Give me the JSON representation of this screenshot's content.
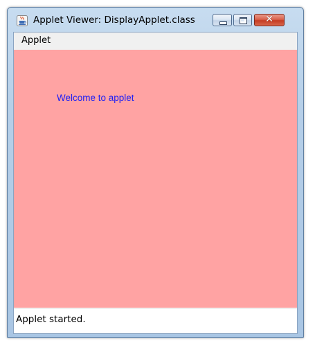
{
  "window": {
    "title": "Applet Viewer: DisplayApplet.class",
    "app_icon": "java-coffee-cup-icon",
    "controls": {
      "minimize_icon": "minimize-icon",
      "maximize_icon": "maximize-icon",
      "close_icon": "close-icon",
      "close_glyph": "✕"
    }
  },
  "menubar": {
    "items": [
      {
        "label": "Applet"
      }
    ]
  },
  "applet": {
    "background_color": "#ffa3a3",
    "text": "Welcome to applet",
    "text_color": "#1f1ff5"
  },
  "status": {
    "text": "Applet started."
  }
}
